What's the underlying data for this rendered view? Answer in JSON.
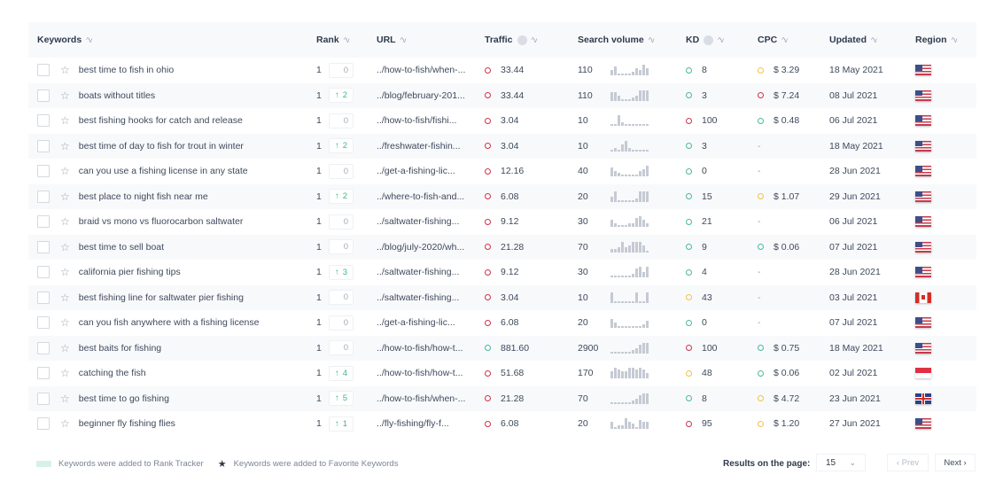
{
  "columns": {
    "keywords": "Keywords",
    "rank": "Rank",
    "url": "URL",
    "traffic": "Traffic",
    "search_volume": "Search volume",
    "kd": "KD",
    "cpc": "CPC",
    "updated": "Updated",
    "region": "Region"
  },
  "sort_glyph": "^v",
  "rows": [
    {
      "keyword": "best time to fish in ohio",
      "rank": "1",
      "change": "0",
      "change_dir": "none",
      "url": "../how-to-fish/when-...",
      "traffic": "33.44",
      "traffic_status": "red",
      "sv": "110",
      "spark": [
        3,
        5,
        1,
        1,
        1,
        1,
        2,
        4,
        3,
        6,
        4
      ],
      "kd": "8",
      "kd_status": "green",
      "cpc": "$ 3.29",
      "cpc_status": "yellow",
      "updated": "18 May 2021",
      "region": "us"
    },
    {
      "keyword": "boats without titles",
      "rank": "1",
      "change": "2",
      "change_dir": "up",
      "url": "../blog/february-201...",
      "traffic": "33.44",
      "traffic_status": "red",
      "sv": "110",
      "spark": [
        5,
        5,
        3,
        1,
        1,
        1,
        2,
        3,
        6,
        6,
        6
      ],
      "kd": "3",
      "kd_status": "green",
      "cpc": "$ 7.24",
      "cpc_status": "red",
      "updated": "08 Jul 2021",
      "region": "us"
    },
    {
      "keyword": "best fishing hooks for catch and release",
      "rank": "1",
      "change": "0",
      "change_dir": "none",
      "url": "../how-to-fish/fishi...",
      "traffic": "3.04",
      "traffic_status": "red",
      "sv": "10",
      "spark": [
        1,
        1,
        6,
        2,
        1,
        1,
        1,
        1,
        1,
        1,
        1
      ],
      "kd": "100",
      "kd_status": "red",
      "cpc": "$ 0.48",
      "cpc_status": "green",
      "updated": "06 Jul 2021",
      "region": "us"
    },
    {
      "keyword": "best time of day to fish for trout in winter",
      "rank": "1",
      "change": "2",
      "change_dir": "up",
      "url": "../freshwater-fishin...",
      "traffic": "3.04",
      "traffic_status": "red",
      "sv": "10",
      "spark": [
        1,
        2,
        1,
        4,
        6,
        2,
        1,
        1,
        1,
        1,
        1
      ],
      "kd": "3",
      "kd_status": "green",
      "cpc": "-",
      "cpc_status": "none",
      "updated": "18 May 2021",
      "region": "us"
    },
    {
      "keyword": "can you use a fishing license in any state",
      "rank": "1",
      "change": "0",
      "change_dir": "none",
      "url": "../get-a-fishing-lic...",
      "traffic": "12.16",
      "traffic_status": "red",
      "sv": "40",
      "spark": [
        5,
        3,
        2,
        1,
        1,
        1,
        1,
        1,
        3,
        4,
        6
      ],
      "kd": "0",
      "kd_status": "green",
      "cpc": "-",
      "cpc_status": "none",
      "updated": "28 Jun 2021",
      "region": "us"
    },
    {
      "keyword": "best place to night fish near me",
      "rank": "1",
      "change": "2",
      "change_dir": "up",
      "url": "../where-to-fish-and...",
      "traffic": "6.08",
      "traffic_status": "red",
      "sv": "20",
      "spark": [
        3,
        6,
        1,
        1,
        1,
        1,
        1,
        2,
        6,
        6,
        6
      ],
      "kd": "15",
      "kd_status": "green",
      "cpc": "$ 1.07",
      "cpc_status": "yellow",
      "updated": "29 Jun 2021",
      "region": "us"
    },
    {
      "keyword": "braid vs mono vs fluorocarbon saltwater",
      "rank": "1",
      "change": "0",
      "change_dir": "none",
      "url": "../saltwater-fishing...",
      "traffic": "9.12",
      "traffic_status": "red",
      "sv": "30",
      "spark": [
        4,
        2,
        1,
        1,
        1,
        2,
        2,
        5,
        6,
        4,
        2
      ],
      "kd": "21",
      "kd_status": "green",
      "cpc": "-",
      "cpc_status": "none",
      "updated": "06 Jul 2021",
      "region": "us"
    },
    {
      "keyword": "best time to sell boat",
      "rank": "1",
      "change": "0",
      "change_dir": "none",
      "url": "../blog/july-2020/wh...",
      "traffic": "21.28",
      "traffic_status": "red",
      "sv": "70",
      "spark": [
        2,
        2,
        3,
        6,
        3,
        4,
        6,
        6,
        6,
        4,
        1
      ],
      "kd": "9",
      "kd_status": "green",
      "cpc": "$ 0.06",
      "cpc_status": "green",
      "updated": "07 Jul 2021",
      "region": "us"
    },
    {
      "keyword": "california pier fishing tips",
      "rank": "1",
      "change": "3",
      "change_dir": "up",
      "url": "../saltwater-fishing...",
      "traffic": "9.12",
      "traffic_status": "red",
      "sv": "30",
      "spark": [
        1,
        1,
        1,
        1,
        1,
        1,
        2,
        5,
        6,
        3,
        6
      ],
      "kd": "4",
      "kd_status": "green",
      "cpc": "-",
      "cpc_status": "none",
      "updated": "28 Jun 2021",
      "region": "us"
    },
    {
      "keyword": "best fishing line for saltwater pier fishing",
      "rank": "1",
      "change": "0",
      "change_dir": "none",
      "url": "../saltwater-fishing...",
      "traffic": "3.04",
      "traffic_status": "red",
      "sv": "10",
      "spark": [
        6,
        1,
        1,
        1,
        1,
        1,
        1,
        6,
        1,
        1,
        6
      ],
      "kd": "43",
      "kd_status": "yellow",
      "cpc": "-",
      "cpc_status": "none",
      "updated": "03 Jul 2021",
      "region": "ca"
    },
    {
      "keyword": "can you fish anywhere with a fishing license",
      "rank": "1",
      "change": "0",
      "change_dir": "none",
      "url": "../get-a-fishing-lic...",
      "traffic": "6.08",
      "traffic_status": "red",
      "sv": "20",
      "spark": [
        5,
        3,
        1,
        1,
        1,
        1,
        1,
        1,
        1,
        2,
        4
      ],
      "kd": "0",
      "kd_status": "green",
      "cpc": "-",
      "cpc_status": "none",
      "updated": "07 Jul 2021",
      "region": "us"
    },
    {
      "keyword": "best baits for fishing",
      "rank": "1",
      "change": "0",
      "change_dir": "none",
      "url": "../how-to-fish/how-t...",
      "traffic": "881.60",
      "traffic_status": "green",
      "sv": "2900",
      "spark": [
        1,
        1,
        1,
        1,
        1,
        1,
        2,
        3,
        5,
        6,
        6
      ],
      "kd": "100",
      "kd_status": "red",
      "cpc": "$ 0.75",
      "cpc_status": "green",
      "updated": "18 May 2021",
      "region": "us"
    },
    {
      "keyword": "catching the fish",
      "rank": "1",
      "change": "4",
      "change_dir": "up",
      "url": "../how-to-fish/how-t...",
      "traffic": "51.68",
      "traffic_status": "red",
      "sv": "170",
      "spark": [
        4,
        6,
        5,
        4,
        4,
        6,
        6,
        5,
        6,
        5,
        3
      ],
      "kd": "48",
      "kd_status": "yellow",
      "cpc": "$ 0.06",
      "cpc_status": "green",
      "updated": "02 Jul 2021",
      "region": "sg"
    },
    {
      "keyword": "best time to go fishing",
      "rank": "1",
      "change": "5",
      "change_dir": "up",
      "url": "../how-to-fish/when-...",
      "traffic": "21.28",
      "traffic_status": "red",
      "sv": "70",
      "spark": [
        1,
        1,
        1,
        1,
        1,
        1,
        2,
        3,
        5,
        6,
        6
      ],
      "kd": "8",
      "kd_status": "green",
      "cpc": "$ 4.72",
      "cpc_status": "yellow",
      "updated": "23 Jun 2021",
      "region": "gb"
    },
    {
      "keyword": "beginner fly fishing flies",
      "rank": "1",
      "change": "1",
      "change_dir": "up",
      "url": "../fly-fishing/fly-f...",
      "traffic": "6.08",
      "traffic_status": "red",
      "sv": "20",
      "spark": [
        4,
        1,
        2,
        2,
        6,
        4,
        3,
        1,
        5,
        4,
        4
      ],
      "kd": "95",
      "kd_status": "red",
      "cpc": "$ 1.20",
      "cpc_status": "yellow",
      "updated": "27 Jun 2021",
      "region": "us"
    }
  ],
  "footer": {
    "legend_rank_tracker": "Keywords were added to Rank Tracker",
    "legend_favorite": "Keywords were added to Favorite Keywords",
    "results_label": "Results on the page:",
    "results_value": "15",
    "prev_label": "‹ Prev",
    "next_label": "Next ›"
  },
  "colors": {
    "red": "#d0324b",
    "green": "#4bb89a",
    "yellow": "#f0c24b",
    "rank_up": "#3fb68b",
    "legend_swatch": "#d8f1e7"
  }
}
